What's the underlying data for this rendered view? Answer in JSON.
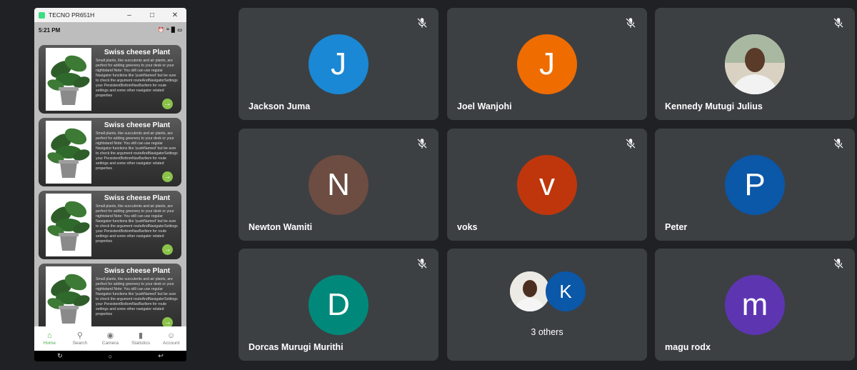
{
  "phone_window": {
    "title": "TECNO PR651H",
    "status_time": "5:21 PM",
    "cards": [
      {
        "title": "Swiss cheese Plant",
        "description": "Small plants, like succulents and air plants, are perfect for adding greenery to your desk or your nightstand Note: You still can use regular Navigator functions like 'pushNamed' but be sure to check the argument routeAndNavigatorSettings your PersistentBottomNavBarItem for route settings and some other navigator related properties"
      },
      {
        "title": "Swiss cheese Plant",
        "description": "Small plants, like succulents and air plants, are perfect for adding greenery to your desk or your nightstand Note: You still can use regular Navigator functions like 'pushNamed' but be sure to check the argument routeAndNavigatorSettings your PersistentBottomNavBarItem for route settings and some other navigator related properties"
      },
      {
        "title": "Swiss cheese Plant",
        "description": "Small plants, like succulents and air plants, are perfect for adding greenery to your desk or your nightstand Note: You still can use regular Navigator functions like 'pushNamed' but be sure to check the argument routeAndNavigatorSettings your PersistentBottomNavBarItem for route settings and some other navigator related properties"
      },
      {
        "title": "Swiss cheese Plant",
        "description": "Small plants, like succulents and air plants, are perfect for adding greenery to your desk or your nightstand Note: You still can use regular Navigator functions like 'pushNamed' but be sure to check the argument routeAndNavigatorSettings your PersistentBottomNavBarItem for route settings and some other navigator related properties"
      }
    ],
    "nav": [
      {
        "label": "Home",
        "icon": "home-icon"
      },
      {
        "label": "Search",
        "icon": "search-icon"
      },
      {
        "label": "Camera",
        "icon": "camera-icon"
      },
      {
        "label": "Statistics",
        "icon": "bar-chart-icon"
      },
      {
        "label": "Account",
        "icon": "person-icon"
      }
    ],
    "accent": "#4caf50"
  },
  "participants": [
    {
      "name": "Jackson Juma",
      "initial": "J",
      "color": "#1a88d4",
      "muted": true
    },
    {
      "name": "Joel Wanjohi",
      "initial": "J",
      "color": "#ef6c00",
      "muted": true
    },
    {
      "name": "Kennedy Mutugi Julius",
      "initial": "",
      "color": "",
      "muted": true,
      "photo": true
    },
    {
      "name": "Newton Wamiti",
      "initial": "N",
      "color": "#6d4c41",
      "muted": true
    },
    {
      "name": "voks",
      "initial": "v",
      "color": "#bf360c",
      "muted": true
    },
    {
      "name": "Peter",
      "initial": "P",
      "color": "#0b57a8",
      "muted": true
    },
    {
      "name": "Dorcas Murugi Murithi",
      "initial": "D",
      "color": "#00897b",
      "muted": true
    },
    {
      "name": "",
      "others_label": "3 others",
      "group_initial": "K",
      "group_color": "#0b57a8",
      "muted": false
    },
    {
      "name": "magu rodx",
      "initial": "m",
      "color": "#5e35b1",
      "muted": true
    }
  ]
}
